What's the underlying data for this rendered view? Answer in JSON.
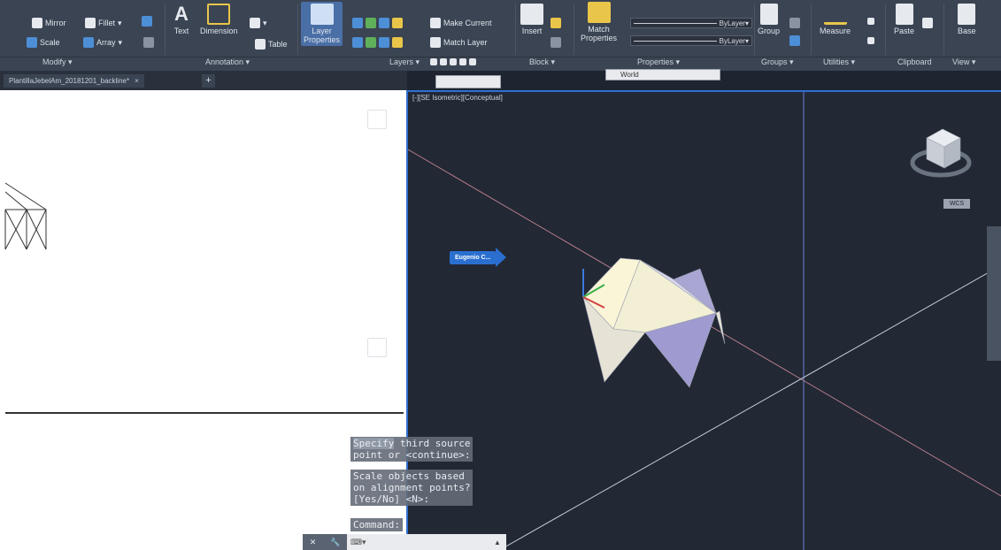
{
  "ribbon": {
    "modify": {
      "mirror": "Mirror",
      "fillet": "Fillet",
      "scale": "Scale",
      "array": "Array",
      "panel_label": "Modify ▾"
    },
    "annotation": {
      "text": "Text",
      "dimension": "Dimension",
      "table": "Table",
      "panel_label": "Annotation ▾"
    },
    "layers": {
      "layer_properties": "Layer\nProperties",
      "make_current": "Make Current",
      "match_layer": "Match Layer",
      "panel_label": "Layers ▾"
    },
    "block": {
      "insert": "Insert",
      "panel_label": "Block ▾"
    },
    "properties": {
      "match_properties": "Match\nProperties",
      "bylayer_1": "ByLayer",
      "bylayer_2": "ByLayer",
      "panel_label": "Properties ▾"
    },
    "groups": {
      "group": "Group",
      "panel_label": "Groups ▾"
    },
    "utilities": {
      "measure": "Measure",
      "panel_label": "Utilities ▾"
    },
    "clipboard": {
      "paste": "Paste",
      "panel_label": "Clipboard"
    },
    "view": {
      "base": "Base",
      "panel_label": "View ▾"
    }
  },
  "file_tab": {
    "name": "PlantillaJebelAm_20181201_backline*",
    "close": "×",
    "plus": "+"
  },
  "world_combo": "World",
  "viewport": {
    "label": "[-][SE Isometric][Conceptual]",
    "tooltip": "Eugenio C...",
    "viewcube_label": "WCS"
  },
  "command_history": [
    {
      "first": "Specify",
      "rest": " third source\npoint or <continue>:"
    },
    {
      "first": "",
      "rest": "Scale objects based\non alignment points?\n[Yes/No] <N>:"
    },
    {
      "first": "",
      "rest": "Command:"
    }
  ],
  "command_input": {
    "close": "✕",
    "wrench": "🔧",
    "prompt": "⌨▾",
    "arrow": "▲"
  },
  "colors": {
    "viewport_bg": "#222834",
    "viewport_border": "#2f6fd0",
    "ribbon_bg": "#3b4453"
  }
}
